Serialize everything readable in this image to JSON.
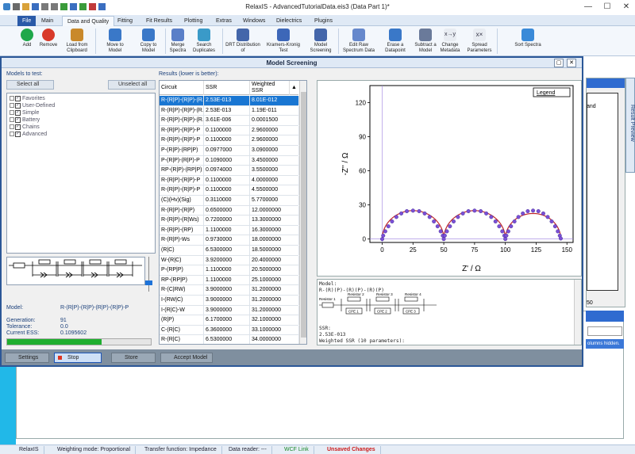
{
  "app": {
    "title": "RelaxIS - AdvancedTutorialData.eis3 (Data Part 1)*"
  },
  "ribbon": {
    "tabs": [
      "File",
      "Main",
      "Data and Quality",
      "Fitting",
      "Fit Results",
      "Plotting",
      "Extras",
      "Windows",
      "Dielectrics",
      "Plugins"
    ],
    "active_tab": "Data and Quality",
    "buttons": [
      {
        "label": "Add",
        "color": "#1fa84a"
      },
      {
        "label": "Remove",
        "color": "#d83a2a"
      },
      {
        "label": "Load from Clipboard",
        "color": "#c9892b"
      },
      {
        "label": "Move to Model",
        "color": "#3a78c8"
      },
      {
        "label": "Copy to Model",
        "color": "#3a78c8"
      },
      {
        "label": "Merge Spectra",
        "color": "#5a7fc8"
      },
      {
        "label": "Search Duplicates",
        "color": "#3a9ac8"
      },
      {
        "label": "DRT Distribution of",
        "color": "#4466aa"
      },
      {
        "label": "Kramers-Kronig Test",
        "color": "#3d67b8"
      },
      {
        "label": "Model Screening",
        "color": "#4466aa"
      },
      {
        "label": "Edit Raw Spectrum Data",
        "color": "#6688cc"
      },
      {
        "label": "Erase a Datapoint",
        "color": "#3a78c8"
      },
      {
        "label": "Subtract a Model",
        "color": "#6a7a9a"
      },
      {
        "label": "Change Metadata",
        "color": "#334"
      },
      {
        "label": "Spread Parameters",
        "color": "#334"
      },
      {
        "label": "Sort Spectra",
        "color": "#3a8ad8"
      }
    ]
  },
  "dialog": {
    "title": "Model Screening",
    "models_label": "Models to test:",
    "select_all": "Select all",
    "unselect_all": "Unselect all",
    "results_label": "Results (lower is better):",
    "tree": [
      "Favorites",
      "User-Defined",
      "Simple",
      "Battery",
      "Chains",
      "Advanced"
    ],
    "model_label": "Model:",
    "model_value": "R-(R|P)-(R|P)-(R|P)-(R|P)-P",
    "generation_label": "Generation:",
    "generation_value": "91",
    "tolerance_label": "Tolerance:",
    "tolerance_value": "0.0",
    "ess_label": "Current ESS:",
    "ess_value": "0.1095602",
    "progress_fraction": 0.66,
    "buttons": {
      "settings": "Settings",
      "stop": "Stop",
      "store": "Store",
      "accept": "Accept Model"
    },
    "table": {
      "headers": [
        "Circuit",
        "SSR",
        "Weighted SSR"
      ],
      "rows": [
        [
          "R-(R|P)-(R|P)-(R...",
          "2.53E-013",
          "8.01E-012"
        ],
        [
          "R-(R|P)-(R|P)-(R...",
          "2.53E-013",
          "1.19E-011"
        ],
        [
          "R-(R|P)-(R|P)-(R...",
          "3.61E-006",
          "0.0001500"
        ],
        [
          "R-(R|P)-(R|P)-P",
          "0.1100000",
          "2.9600000"
        ],
        [
          "R-(R|P)-(R|P)-P",
          "0.1100000",
          "2.9600000"
        ],
        [
          "P-(R|P)-(RP|P)",
          "0.0977000",
          "3.0900000"
        ],
        [
          "P-(R|P)-(R|P)-P",
          "0.1090000",
          "3.4500000"
        ],
        [
          "RP-(R|P)-(RP|P)",
          "0.0974000",
          "3.5500000"
        ],
        [
          "R-(R|P)-(R|P)-P",
          "0.1100000",
          "4.0000000"
        ],
        [
          "R-(R|P)-(R|P)-P",
          "0.1100000",
          "4.5500000"
        ],
        [
          "(C)(Hv)(Sig)",
          "0.3110000",
          "5.7700000"
        ],
        [
          "R-(R|P)-(R|P)",
          "0.6500000",
          "12.0000000"
        ],
        [
          "R-(R|P)-(R|Ws)",
          "0.7200000",
          "13.3000000"
        ],
        [
          "R-(R|P)-(RP)",
          "1.1100000",
          "16.3000000"
        ],
        [
          "R-(R|P)-Ws",
          "0.9730000",
          "18.0000000"
        ],
        [
          "(R|C)",
          "6.5300000",
          "18.5000000"
        ],
        [
          "W-(R|C)",
          "3.9200000",
          "20.4000000"
        ],
        [
          "P-(RP|P)",
          "1.1100000",
          "20.5000000"
        ],
        [
          "RP-(RP|P)",
          "1.1100000",
          "25.1000000"
        ],
        [
          "R-(C|RW)",
          "3.9000000",
          "31.2000000"
        ],
        [
          "I-(RW|C)",
          "3.9000000",
          "31.2000000"
        ],
        [
          "I-(R|C)-W",
          "3.9000000",
          "31.2000000"
        ],
        [
          "(R|P)",
          "6.1700000",
          "32.1000000"
        ],
        [
          "C-(R|C)",
          "6.3600000",
          "33.1000000"
        ],
        [
          "R-(R|C)",
          "6.5300000",
          "34.0000000"
        ]
      ]
    },
    "model_text": [
      "Model:",
      "R-(R)(P)-(R)(P)-(R)(P)",
      "",
      "",
      "",
      "",
      "",
      "SSR:",
      "2.53E-013",
      "Weighted SSR (10 parameters):"
    ],
    "schematic": {
      "labels": [
        "Resistor 1",
        "Resistor 2",
        "Resistor 3",
        "Resistor 4"
      ],
      "cpe": [
        "CPE 1",
        "CPE 2",
        "CPE 3"
      ]
    }
  },
  "chart_data": {
    "type": "scatter",
    "title": "",
    "xlabel": "Z' / Ω",
    "ylabel": "-Z'' / Ω",
    "xlim": [
      -10,
      155
    ],
    "ylim": [
      -3,
      135
    ],
    "xticks": [
      0,
      25,
      50,
      75,
      100,
      125,
      150
    ],
    "yticks": [
      0.0,
      30,
      60,
      90,
      120
    ],
    "legend": "Legend",
    "legend_placement": "top-right",
    "marker_color": "#7b4fd6",
    "line_color": "#c0262b",
    "arcs": [
      {
        "start": 0,
        "end": 50
      },
      {
        "start": 50,
        "end": 100
      },
      {
        "start": 100,
        "end": 145
      }
    ],
    "points": [
      [
        0.0,
        0.0
      ],
      [
        0.8,
        3.0
      ],
      [
        2.5,
        6.8
      ],
      [
        5.0,
        11.2
      ],
      [
        8.0,
        15.5
      ],
      [
        11.5,
        19.4
      ],
      [
        15.5,
        22.5
      ],
      [
        20.0,
        24.5
      ],
      [
        25.0,
        25.0
      ],
      [
        30.0,
        24.5
      ],
      [
        34.5,
        22.5
      ],
      [
        38.5,
        19.4
      ],
      [
        42.0,
        15.5
      ],
      [
        45.0,
        11.2
      ],
      [
        47.5,
        6.8
      ],
      [
        49.2,
        3.0
      ],
      [
        50.0,
        0.0
      ],
      [
        50.8,
        3.0
      ],
      [
        52.5,
        6.8
      ],
      [
        55.0,
        11.2
      ],
      [
        58.0,
        15.5
      ],
      [
        61.5,
        19.4
      ],
      [
        65.5,
        22.5
      ],
      [
        70.0,
        24.5
      ],
      [
        75.0,
        25.0
      ],
      [
        80.0,
        24.5
      ],
      [
        84.5,
        22.5
      ],
      [
        88.5,
        19.4
      ],
      [
        92.0,
        15.5
      ],
      [
        95.0,
        11.2
      ],
      [
        97.5,
        6.8
      ],
      [
        99.2,
        3.0
      ],
      [
        100.0,
        0.0
      ],
      [
        100.8,
        3.0
      ],
      [
        102.4,
        6.8
      ],
      [
        104.6,
        11.2
      ],
      [
        107.4,
        15.5
      ],
      [
        110.6,
        19.4
      ],
      [
        114.2,
        22.5
      ],
      [
        118.2,
        24.5
      ],
      [
        122.5,
        25.0
      ],
      [
        126.8,
        24.5
      ],
      [
        130.8,
        22.5
      ],
      [
        134.4,
        19.4
      ],
      [
        137.6,
        15.5
      ],
      [
        140.4,
        11.2
      ],
      [
        142.6,
        6.8
      ],
      [
        144.2,
        3.0
      ],
      [
        145.0,
        0.5
      ]
    ]
  },
  "background": {
    "bottom_panel_text": "olumns hidden.",
    "right_panel_text": "and",
    "right_panel_number": "50",
    "result_preview": "Result Preview"
  },
  "statusbar": {
    "items": [
      {
        "text": "RelaxIS",
        "color": "#223"
      },
      {
        "text": "Weighting mode: Proportional",
        "color": "#223"
      },
      {
        "text": "Transfer function: Impedance",
        "color": "#223"
      },
      {
        "text": "Data reader: ---",
        "color": "#223"
      },
      {
        "text": "WCF Link",
        "color": "#1a8a2a"
      },
      {
        "text": "Unsaved Changes",
        "color": "#cc1a1a"
      }
    ]
  }
}
